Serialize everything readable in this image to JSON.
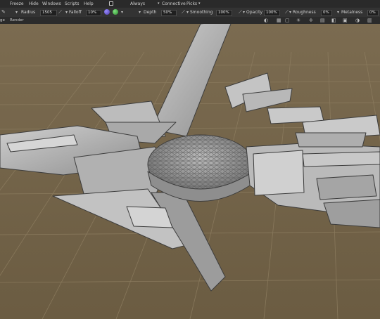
{
  "menu": {
    "items": [
      "Freeze",
      "Hide",
      "Windows",
      "Scripts",
      "Help"
    ],
    "always_label": "Always",
    "connective_label": "Connective",
    "picks_label": "Picks"
  },
  "toolbar": {
    "radius": {
      "label": "Radius",
      "value": "1505"
    },
    "falloff": {
      "label": "Falloff",
      "value": "10%"
    },
    "depth": {
      "label": "Depth",
      "value": "50%"
    },
    "smoothing": {
      "label": "Smoothing",
      "value": "100%"
    },
    "opacity": {
      "label": "Opacity",
      "value": "100%"
    },
    "roughness": {
      "label": "Roughness",
      "value": "0%"
    },
    "metalness": {
      "label": "Metalness",
      "value": "0%"
    }
  },
  "subbar": {
    "items": [
      "ge",
      "Render"
    ]
  },
  "viewport": {
    "colors": {
      "floor": "#6f6047",
      "grid": "#8a7a5e",
      "mesh": "#b5b5b5"
    },
    "icons": [
      "camera-icon",
      "grid-icon",
      "frame-icon",
      "light-icon",
      "axis-icon",
      "layout-icon",
      "view-icon",
      "render-icon",
      "display-icon",
      "lock-icon"
    ]
  }
}
